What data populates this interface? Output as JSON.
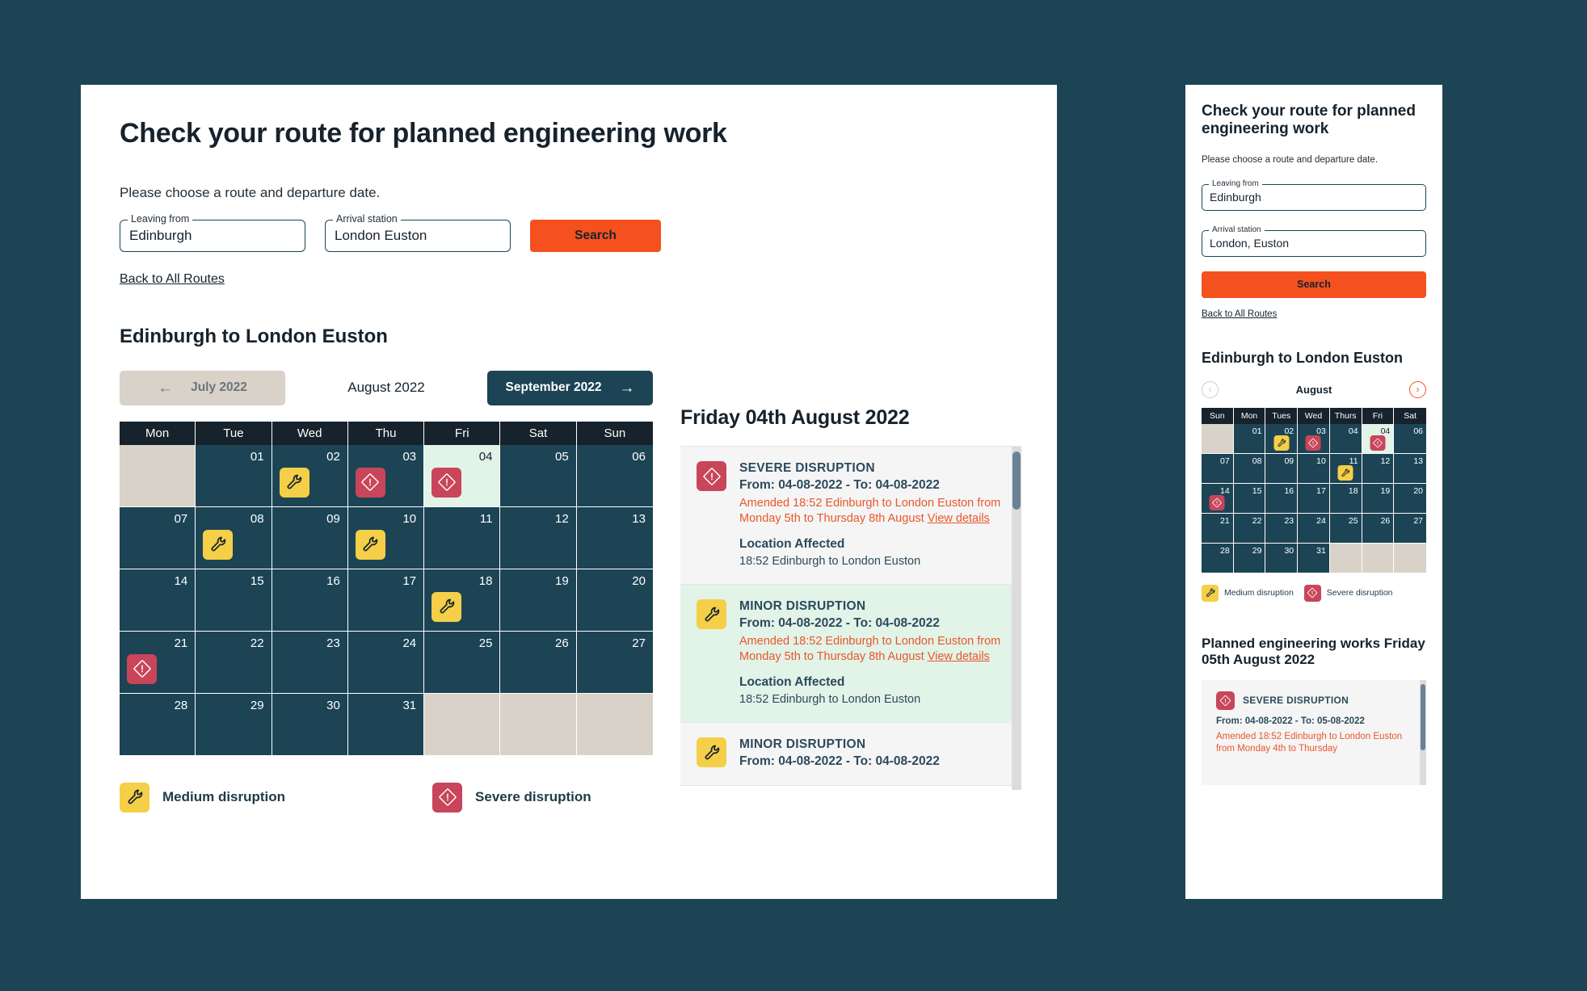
{
  "colors": {
    "page_bg": "#1c4455",
    "accent_orange": "#f4511e",
    "dark_navy": "#16222c",
    "cal_cell": "#1c4455",
    "empty_cell": "#d8d2c9",
    "selected_cell": "#e2f3e8",
    "medium_badge": "#f5cf47",
    "severe_badge": "#c9455a"
  },
  "desktop": {
    "page_title": "Check your route for planned engineering work",
    "lede": "Please choose a route and departure date.",
    "form": {
      "leaving_label": "Leaving from",
      "leaving_value": "Edinburgh",
      "arrival_label": "Arrival station",
      "arrival_value": "London Euston",
      "search_label": "Search"
    },
    "back_link": "Back to All Routes",
    "route_title": "Edinburgh to London Euston",
    "month_nav": {
      "prev_label": "July 2022",
      "prev_icon": "arrow-left-icon",
      "current_label": "August 2022",
      "next_label": "September 2022",
      "next_icon": "arrow-right-icon"
    },
    "calendar": {
      "weekdays": [
        "Mon",
        "Tue",
        "Wed",
        "Thu",
        "Fri",
        "Sat",
        "Sun"
      ],
      "rows": [
        [
          {
            "day": "",
            "empty": true
          },
          {
            "day": "01"
          },
          {
            "day": "02",
            "badge": "medium"
          },
          {
            "day": "03",
            "badge": "severe"
          },
          {
            "day": "04",
            "badge": "severe",
            "selected": true
          },
          {
            "day": "05"
          },
          {
            "day": "06"
          }
        ],
        [
          {
            "day": "07"
          },
          {
            "day": "08",
            "badge": "medium"
          },
          {
            "day": "09"
          },
          {
            "day": "10",
            "badge": "medium"
          },
          {
            "day": "11"
          },
          {
            "day": "12"
          },
          {
            "day": "13"
          }
        ],
        [
          {
            "day": "14"
          },
          {
            "day": "15"
          },
          {
            "day": "16"
          },
          {
            "day": "17"
          },
          {
            "day": "18",
            "badge": "medium"
          },
          {
            "day": "19"
          },
          {
            "day": "20"
          }
        ],
        [
          {
            "day": "21",
            "badge": "severe"
          },
          {
            "day": "22"
          },
          {
            "day": "23"
          },
          {
            "day": "24"
          },
          {
            "day": "25"
          },
          {
            "day": "26"
          },
          {
            "day": "27"
          }
        ],
        [
          {
            "day": "28"
          },
          {
            "day": "29"
          },
          {
            "day": "30"
          },
          {
            "day": "31"
          },
          {
            "day": "",
            "empty": true
          },
          {
            "day": "",
            "empty": true
          },
          {
            "day": "",
            "empty": true
          }
        ]
      ]
    },
    "legend": [
      {
        "badge": "medium",
        "label": "Medium disruption"
      },
      {
        "badge": "severe",
        "label": "Severe disruption"
      }
    ],
    "detail": {
      "title": "Friday 04th August 2022",
      "items": [
        {
          "badge": "severe",
          "tone": "grey",
          "kind": "SEVERE DISRUPTION",
          "dates": "From: 04-08-2022 - To: 04-08-2022",
          "amended": "Amended 18:52 Edinburgh to London Euston from Monday 5th to Thursday 8th August",
          "view_details": "View details",
          "location_heading": "Location Affected",
          "location": "18:52 Edinburgh to London Euston"
        },
        {
          "badge": "medium",
          "tone": "green",
          "kind": "MINOR DISRUPTION",
          "dates": "From: 04-08-2022 - To: 04-08-2022",
          "amended": "Amended 18:52 Edinburgh to London Euston from Monday 5th to Thursday 8th August",
          "view_details": "View details",
          "location_heading": "Location Affected",
          "location": "18:52 Edinburgh to London Euston"
        },
        {
          "badge": "medium",
          "tone": "grey",
          "kind": "MINOR DISRUPTION",
          "dates": "From: 04-08-2022 - To: 04-08-2022"
        }
      ]
    }
  },
  "mobile": {
    "page_title": "Check your route for planned engineering work",
    "lede": "Please choose a route and departure date.",
    "form": {
      "leaving_label": "Leaving from",
      "leaving_value": "Edinburgh",
      "arrival_label": "Arrival station",
      "arrival_value": "London, Euston",
      "search_label": "Search"
    },
    "back_link": "Back to All Routes",
    "route_title": "Edinburgh to London Euston",
    "month_nav": {
      "prev_icon": "chevron-left-icon",
      "current_label": "August",
      "next_icon": "chevron-right-icon"
    },
    "calendar": {
      "weekdays": [
        "Sun",
        "Mon",
        "Tues",
        "Wed",
        "Thurs",
        "Fri",
        "Sat"
      ],
      "rows": [
        [
          {
            "day": "",
            "empty": true
          },
          {
            "day": "01"
          },
          {
            "day": "02",
            "badge": "medium"
          },
          {
            "day": "03",
            "badge": "severe"
          },
          {
            "day": "04"
          },
          {
            "day": "04",
            "badge": "severe",
            "selected": true
          },
          {
            "day": "06"
          }
        ],
        [
          {
            "day": "07"
          },
          {
            "day": "08"
          },
          {
            "day": "09"
          },
          {
            "day": "10"
          },
          {
            "day": "11",
            "badge": "medium"
          },
          {
            "day": "12"
          },
          {
            "day": "13"
          }
        ],
        [
          {
            "day": "14",
            "badge": "severe"
          },
          {
            "day": "15"
          },
          {
            "day": "16"
          },
          {
            "day": "17"
          },
          {
            "day": "18"
          },
          {
            "day": "19"
          },
          {
            "day": "20"
          }
        ],
        [
          {
            "day": "21"
          },
          {
            "day": "22"
          },
          {
            "day": "23"
          },
          {
            "day": "24"
          },
          {
            "day": "25"
          },
          {
            "day": "26"
          },
          {
            "day": "27"
          }
        ],
        [
          {
            "day": "28"
          },
          {
            "day": "29"
          },
          {
            "day": "30"
          },
          {
            "day": "31"
          },
          {
            "day": "",
            "empty": true
          },
          {
            "day": "",
            "empty": true
          },
          {
            "day": "",
            "empty": true
          }
        ]
      ]
    },
    "legend": [
      {
        "badge": "medium",
        "label": "Medium disruption"
      },
      {
        "badge": "severe",
        "label": "Severe disruption"
      }
    ],
    "works_title": "Planned engineering works Friday 05th August 2022",
    "detail": {
      "items": [
        {
          "badge": "severe",
          "kind": "SEVERE DISRUPTION",
          "dates": "From: 04-08-2022 - To: 05-08-2022",
          "amended": "Amended 18:52 Edinburgh to London Euston from Monday 4th to Thursday"
        }
      ]
    }
  }
}
